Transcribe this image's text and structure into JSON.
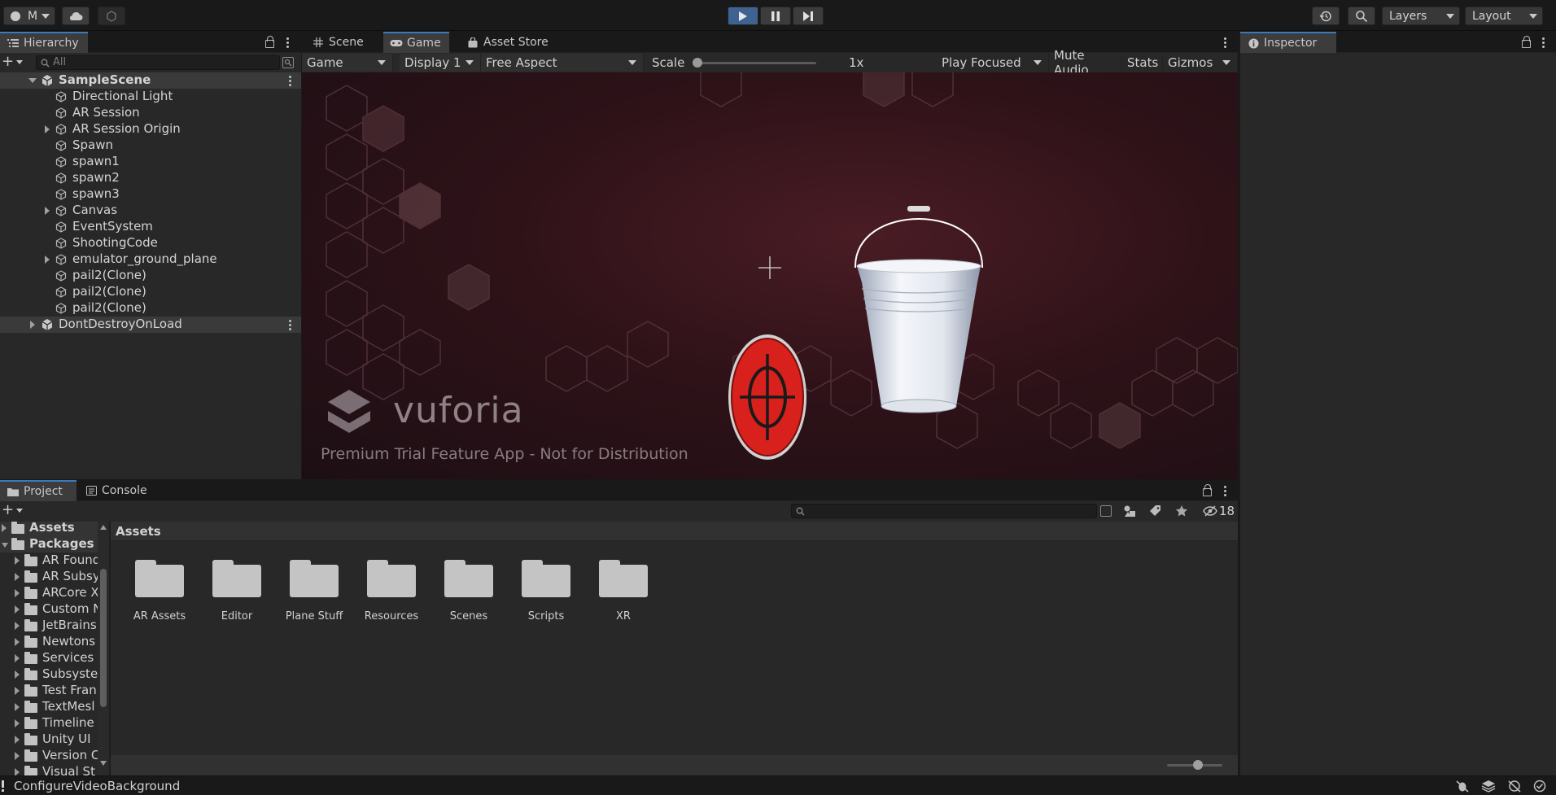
{
  "toolbar": {
    "account_label": "M",
    "layers_label": "Layers",
    "layout_label": "Layout"
  },
  "hierarchy": {
    "tab_label": "Hierarchy",
    "search_placeholder": "All",
    "scene": "SampleScene",
    "items": [
      {
        "label": "Directional Light",
        "expandable": false
      },
      {
        "label": "AR Session",
        "expandable": false
      },
      {
        "label": "AR Session Origin",
        "expandable": true
      },
      {
        "label": "Spawn",
        "expandable": false
      },
      {
        "label": "spawn1",
        "expandable": false
      },
      {
        "label": "spawn2",
        "expandable": false
      },
      {
        "label": "spawn3",
        "expandable": false
      },
      {
        "label": "Canvas",
        "expandable": true
      },
      {
        "label": "EventSystem",
        "expandable": false
      },
      {
        "label": "ShootingCode",
        "expandable": false
      },
      {
        "label": "emulator_ground_plane",
        "expandable": true
      },
      {
        "label": "pail2(Clone)",
        "expandable": false
      },
      {
        "label": "pail2(Clone)",
        "expandable": false
      },
      {
        "label": "pail2(Clone)",
        "expandable": false
      }
    ],
    "dont_destroy": "DontDestroyOnLoad"
  },
  "center_tabs": {
    "scene": "Scene",
    "game": "Game",
    "asset_store": "Asset Store"
  },
  "gamebar": {
    "view": "Game",
    "display": "Display 1",
    "aspect": "Free Aspect",
    "scale_label": "Scale",
    "scale_value": "1x",
    "play_mode": "Play Focused",
    "mute": "Mute Audio",
    "stats": "Stats",
    "gizmos": "Gizmos"
  },
  "game_view": {
    "watermark_brand": "vuforia",
    "watermark_note": "Premium Trial Feature App - Not for Distribution"
  },
  "inspector": {
    "tab_label": "Inspector"
  },
  "project": {
    "tab_project": "Project",
    "tab_console": "Console",
    "hidden_count": "18",
    "breadcrumb": "Assets",
    "tree": {
      "assets": "Assets",
      "packages": "Packages",
      "items": [
        "AR Found",
        "AR Subsy",
        "ARCore X",
        "Custom N",
        "JetBrains",
        "Newtons",
        "Services",
        "Subsyste",
        "Test Fran",
        "TextMesl",
        "Timeline",
        "Unity UI",
        "Version C",
        "Visual St"
      ]
    },
    "folders": [
      "AR Assets",
      "Editor",
      "Plane Stuff",
      "Resources",
      "Scenes",
      "Scripts",
      "XR"
    ]
  },
  "status": {
    "message": "ConfigureVideoBackground"
  },
  "colors": {
    "accent": "#3a79bb",
    "play_active": "#3f6391",
    "panel": "#282828",
    "chrome": "#191919",
    "target_red": "#d8201c"
  }
}
